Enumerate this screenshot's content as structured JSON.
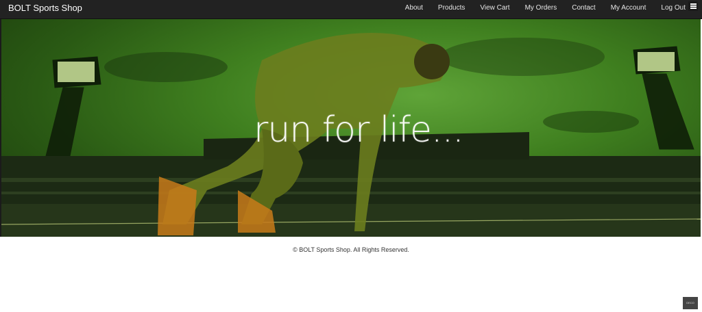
{
  "header": {
    "brand": "BOLT Sports Shop",
    "nav": [
      "About",
      "Products",
      "View Cart",
      "My Orders",
      "Contact",
      "My Account",
      "Log Out"
    ]
  },
  "hero": {
    "tagline": "run for life..."
  },
  "footer": {
    "copyright": "© BOLT Sports Shop. All Rights Reserved."
  },
  "colors": {
    "navbar": "#222222",
    "hero_tint": "#3f7f1f",
    "footer_bg": "#ffffff"
  },
  "icons": [
    "hamburger-menu-icon"
  ]
}
